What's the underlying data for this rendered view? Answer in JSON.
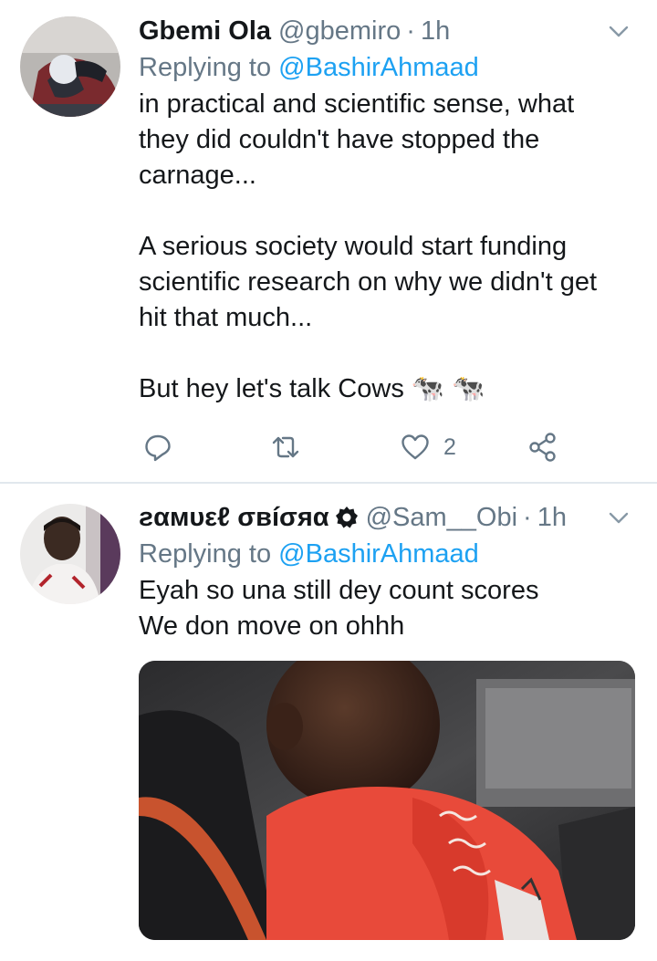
{
  "tweets": [
    {
      "display_name": "Gbemi Ola",
      "handle": "@gbemiro",
      "separator": "·",
      "time": "1h",
      "replying_prefix": "Replying to",
      "replying_to": "@BashirAhmaad",
      "text": "in practical and scientific sense, what\nthey did couldn't have stopped the\ncarnage...\n\nA serious society would start funding\nscientific research on why we didn't get\nhit that much...\n\nBut hey let's talk Cows 🐄 🐄",
      "like_count": "2",
      "icons": [
        "chevron-down-icon",
        "reply-icon",
        "retweet-icon",
        "like-icon",
        "share-icon"
      ]
    },
    {
      "display_name": "ƨαмυεℓ σвíσяα",
      "handle": "@Sam__Obi",
      "separator": "·",
      "time": "1h",
      "replying_prefix": "Replying to",
      "replying_to": "@BashirAhmaad",
      "text": "Eyah so una still dey count scores\nWe don move on ohhh",
      "icons": [
        "chevron-down-icon",
        "badge-icon"
      ]
    }
  ],
  "colors": {
    "link": "#1da1f2",
    "secondary_text": "#657786",
    "divider": "#e1e8ed"
  }
}
